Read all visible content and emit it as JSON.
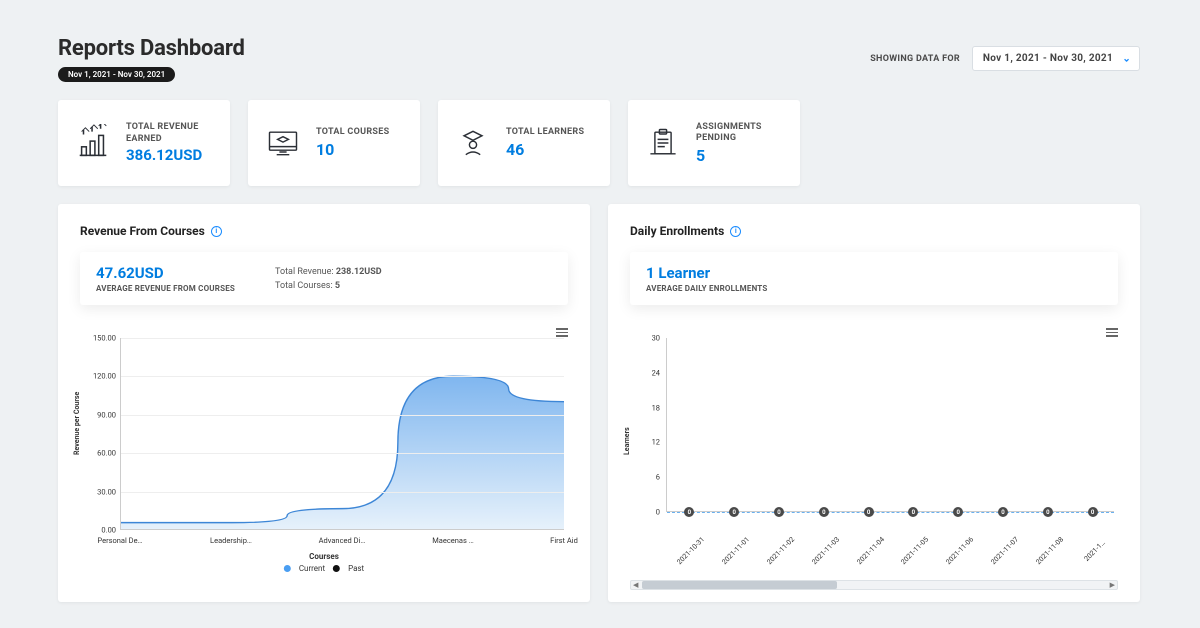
{
  "header": {
    "title": "Reports Dashboard",
    "date_pill": "Nov 1, 2021 - Nov 30, 2021",
    "showing_label": "SHOWING DATA FOR",
    "date_selected": "Nov 1, 2021 - Nov 30, 2021"
  },
  "stats": [
    {
      "label": "TOTAL REVENUE EARNED",
      "value": "386.12USD",
      "icon": "bars-growth-icon"
    },
    {
      "label": "TOTAL COURSES",
      "value": "10",
      "icon": "monitor-grad-icon"
    },
    {
      "label": "TOTAL LEARNERS",
      "value": "46",
      "icon": "student-icon"
    },
    {
      "label": "ASSIGNMENTS PENDING",
      "value": "5",
      "icon": "doc-clip-icon"
    }
  ],
  "revenue": {
    "panel_title": "Revenue From Courses",
    "avg_value": "47.62USD",
    "avg_label": "AVERAGE REVENUE FROM COURSES",
    "total_revenue_label": "Total Revenue:",
    "total_revenue_value": "238.12USD",
    "total_courses_label": "Total Courses:",
    "total_courses_value": "5",
    "ylabel": "Revenue per Course",
    "xlabel": "Courses",
    "legend_current": "Current",
    "legend_past": "Past"
  },
  "enroll": {
    "panel_title": "Daily Enrollments",
    "avg_value": "1 Learner",
    "avg_label": "AVERAGE DAILY ENROLLMENTS",
    "ylabel": "Learners"
  },
  "chart_data": [
    {
      "type": "area",
      "title": "Revenue From Courses",
      "xlabel": "Courses",
      "ylabel": "Revenue per Course",
      "ylim": [
        0,
        150
      ],
      "yticks": [
        0.0,
        30.0,
        60.0,
        90.0,
        120.0,
        150.0
      ],
      "categories": [
        "Personal De…",
        "Leadership…",
        "Advanced Di…",
        "Maecenas …",
        "First Aid"
      ],
      "series": [
        {
          "name": "Current",
          "values": [
            5,
            5,
            16,
            120,
            100
          ]
        },
        {
          "name": "Past",
          "values": [
            0,
            0,
            0,
            0,
            0
          ]
        }
      ]
    },
    {
      "type": "line",
      "title": "Daily Enrollments",
      "xlabel": "",
      "ylabel": "Learners",
      "ylim": [
        0,
        30
      ],
      "yticks": [
        0,
        6,
        12,
        18,
        24,
        30
      ],
      "categories": [
        "2021-10-31",
        "2021-11-01",
        "2021-11-02",
        "2021-11-03",
        "2021-11-04",
        "2021-11-05",
        "2021-11-06",
        "2021-11-07",
        "2021-11-08",
        "2021-1…"
      ],
      "series": [
        {
          "name": "Learners",
          "values": [
            0,
            0,
            0,
            0,
            0,
            0,
            0,
            0,
            0,
            0
          ]
        }
      ]
    }
  ]
}
